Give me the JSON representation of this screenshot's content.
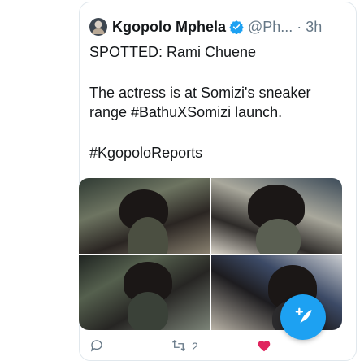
{
  "tweet": {
    "author_name": "Kgopolo Mphela",
    "handle_time": "@Ph... · 3h",
    "lines": [
      "SPOTTED: Rami Chuene",
      "The actress is at Somizi's sneaker",
      "range #BathuXSomizi launch.",
      "#KgopoloReports"
    ],
    "retweet_count": "2"
  },
  "colors": {
    "accent": "#1da1f2",
    "secondary_text": "#657786",
    "like": "#e0245e"
  },
  "icons": {
    "verified": "verified-badge-icon",
    "reply": "reply-icon",
    "retweet": "retweet-icon",
    "like": "heart-icon",
    "compose": "compose-tweet-icon"
  }
}
